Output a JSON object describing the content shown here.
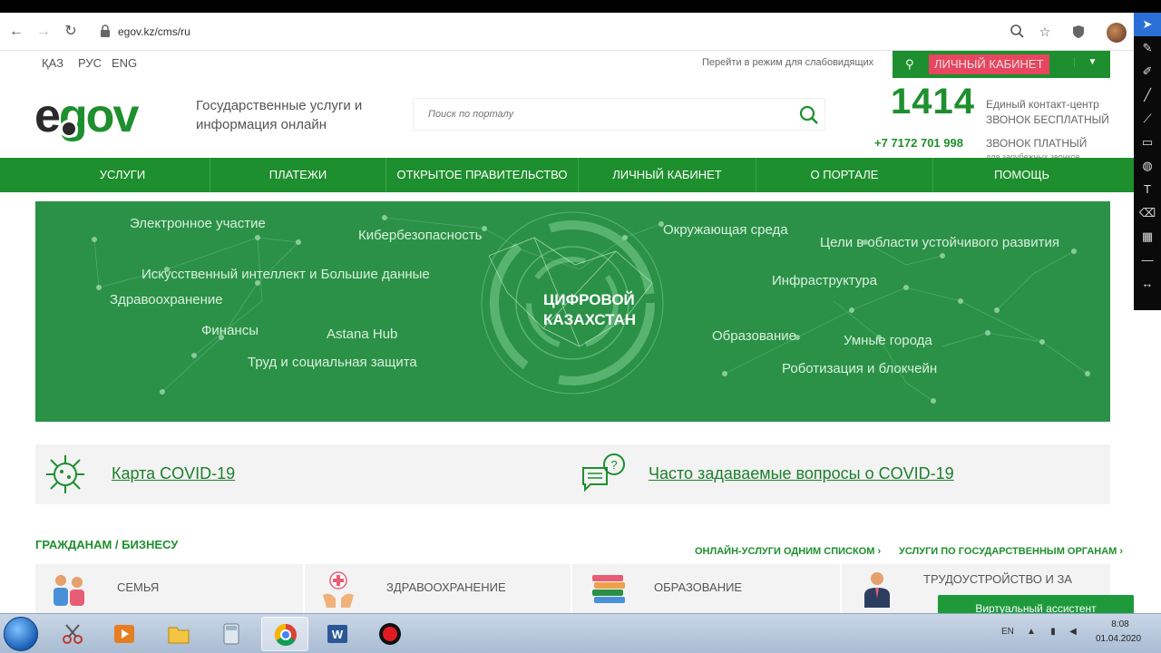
{
  "browser": {
    "url": "egov.kz/cms/ru",
    "back_icon": "←",
    "forward_icon": "→",
    "reload_icon": "↻",
    "zoom_icon": "zoom-icon",
    "star_icon": "☆",
    "shield_icon": "shield-icon"
  },
  "topbar": {
    "languages": [
      "ҚАЗ",
      "РУС",
      "ENG"
    ],
    "impaired_mode": "Перейти в режим для слабовидящих",
    "cabinet_label": "ЛИЧНЫЙ КАБИНЕТ",
    "cabinet_label_bg": "#e84560"
  },
  "header": {
    "logo_e": "e",
    "logo_gov": "gov",
    "tagline": "Государственные услуги и информация онлайн",
    "search_placeholder": "Поиск по порталу",
    "phone_short": "1414",
    "phone_short_desc1": "Единый контакт-центр",
    "phone_short_desc2": "ЗВОНОК БЕСПЛАТНЫЙ",
    "phone_long": "+7 7172 701 998",
    "phone_long_desc1": "ЗВОНОК ПЛАТНЫЙ",
    "phone_long_desc2": "для зарубежных звонков"
  },
  "nav": [
    "УСЛУГИ",
    "ПЛАТЕЖИ",
    "ОТКРЫТОЕ ПРАВИТЕЛЬСТВО",
    "ЛИЧНЫЙ КАБИНЕТ",
    "О ПОРТАЛЕ",
    "ПОМОЩЬ"
  ],
  "banner": {
    "title_line1": "ЦИФРОВОЙ",
    "title_line2": "КАЗАХСТАН",
    "topics": [
      "Электронное участие",
      "Кибербезопасность",
      "Окружающая среда",
      "Цели в области устойчивого развития",
      "Искусственный интеллект и Большие данные",
      "Инфраструктура",
      "Здравоохранение",
      "Финансы",
      "Astana Hub",
      "Образование",
      "Умные города",
      "Труд и социальная защита",
      "Роботизация и блокчейн"
    ]
  },
  "covid": {
    "map_link": "Карта COVID-19",
    "faq_link": "Часто задаваемые вопросы о COVID-19"
  },
  "sections": {
    "title": "ГРАЖДАНАМ / БИЗНЕСУ",
    "online_list_link": "ОНЛАЙН-УСЛУГИ ОДНИМ СПИСКОМ ›",
    "by_agency_link": "УСЛУГИ ПО ГОСУДАРСТВЕННЫМ ОРГАНАМ ›",
    "categories": [
      "СЕМЬЯ",
      "ЗДРАВООХРАНЕНИЕ",
      "ОБРАЗОВАНИЕ",
      "ТРУДОУСТРОЙСТВО И ЗА"
    ]
  },
  "assistant": "Виртуальный ассистент",
  "taskbar": {
    "lang": "EN",
    "time": "8:08",
    "date": "01.04.2020"
  },
  "colors": {
    "brand_green": "#1e8f2e",
    "banner_green": "#2b9147"
  }
}
